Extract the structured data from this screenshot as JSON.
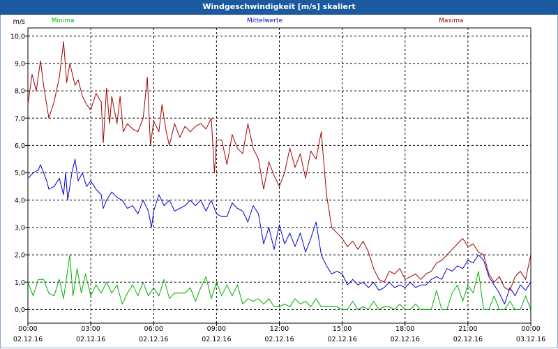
{
  "window": {
    "title": "Windgeschwindigkeit [m/s] skaliert"
  },
  "colors": {
    "min": "#00b000",
    "avg": "#0000c8",
    "max": "#a00000",
    "grid": "#000000",
    "title_bg": "#1c5aa0"
  },
  "chart_data": {
    "type": "line",
    "title": "Windgeschwindigkeit [m/s] skaliert",
    "ylabel": "m/s",
    "ylim": [
      -0.5,
      10.3
    ],
    "xlim": [
      0,
      24
    ],
    "grid": true,
    "yticks": [
      0,
      1,
      2,
      3,
      4,
      5,
      6,
      7,
      8,
      9,
      10
    ],
    "ytick_labels": [
      "0,0",
      "1,0",
      "2,0",
      "3,0",
      "4,0",
      "5,0",
      "6,0",
      "7,0",
      "8,0",
      "9,0",
      "10,0"
    ],
    "x_ticks": [
      0,
      3,
      6,
      9,
      12,
      15,
      18,
      21,
      24
    ],
    "x_time_labels": [
      "00:00",
      "03:00",
      "06:00",
      "09:00",
      "12:00",
      "15:00",
      "18:00",
      "21:00",
      "00:00"
    ],
    "x_date_labels": [
      "02.12.16",
      "02.12.16",
      "02.12.16",
      "02.12.16",
      "02.12.16",
      "02.12.16",
      "02.12.16",
      "02.12.16",
      "03.12.16"
    ],
    "series": [
      {
        "name": "Minima",
        "color": "#00b000",
        "points": [
          [
            0,
            1.0
          ],
          [
            0.25,
            0.5
          ],
          [
            0.5,
            1.1
          ],
          [
            0.75,
            1.1
          ],
          [
            1.0,
            0.6
          ],
          [
            1.25,
            0.5
          ],
          [
            1.5,
            1.1
          ],
          [
            1.7,
            0.4
          ],
          [
            2.0,
            2.0
          ],
          [
            2.15,
            0.5
          ],
          [
            2.35,
            1.5
          ],
          [
            2.55,
            0.6
          ],
          [
            2.75,
            1.3
          ],
          [
            3.0,
            0.5
          ],
          [
            3.25,
            0.9
          ],
          [
            3.5,
            0.6
          ],
          [
            3.75,
            1.0
          ],
          [
            4.0,
            0.6
          ],
          [
            4.25,
            0.9
          ],
          [
            4.5,
            0.2
          ],
          [
            4.75,
            0.6
          ],
          [
            5.0,
            0.9
          ],
          [
            5.25,
            0.5
          ],
          [
            5.5,
            1.0
          ],
          [
            5.75,
            0.5
          ],
          [
            6.0,
            0.8
          ],
          [
            6.25,
            0.5
          ],
          [
            6.5,
            1.1
          ],
          [
            6.75,
            0.4
          ],
          [
            7.0,
            0.6
          ],
          [
            7.25,
            0.6
          ],
          [
            7.5,
            0.6
          ],
          [
            7.75,
            0.8
          ],
          [
            8.0,
            0.3
          ],
          [
            8.25,
            0.8
          ],
          [
            8.5,
            1.2
          ],
          [
            8.75,
            0.4
          ],
          [
            9.0,
            1.0
          ],
          [
            9.25,
            0.5
          ],
          [
            9.5,
            0.9
          ],
          [
            9.75,
            0.5
          ],
          [
            10.0,
            0.9
          ],
          [
            10.25,
            0.2
          ],
          [
            10.5,
            0.4
          ],
          [
            10.75,
            0.3
          ],
          [
            11.0,
            0.4
          ],
          [
            11.25,
            0.2
          ],
          [
            11.5,
            0.4
          ],
          [
            11.75,
            0.1
          ],
          [
            12.0,
            0.1
          ],
          [
            12.25,
            0.2
          ],
          [
            12.5,
            0.1
          ],
          [
            12.75,
            0.4
          ],
          [
            13.0,
            0.2
          ],
          [
            13.25,
            0.3
          ],
          [
            13.5,
            0.1
          ],
          [
            13.75,
            0.4
          ],
          [
            14.0,
            0.1
          ],
          [
            14.5,
            0.1
          ],
          [
            14.75,
            0.1
          ],
          [
            15.0,
            0.0
          ],
          [
            15.25,
            0.0
          ],
          [
            15.5,
            0.3
          ],
          [
            15.75,
            0.0
          ],
          [
            16.0,
            0.1
          ],
          [
            16.25,
            0.0
          ],
          [
            16.5,
            0.3
          ],
          [
            16.75,
            0.0
          ],
          [
            17.0,
            0.1
          ],
          [
            17.25,
            0.1
          ],
          [
            17.5,
            0.0
          ],
          [
            17.75,
            0.2
          ],
          [
            18.0,
            0.0
          ],
          [
            18.25,
            0.0
          ],
          [
            18.5,
            0.2
          ],
          [
            18.75,
            0.0
          ],
          [
            19.0,
            0.0
          ],
          [
            19.25,
            0.0
          ],
          [
            19.5,
            0.7
          ],
          [
            19.75,
            0.0
          ],
          [
            20.0,
            0.0
          ],
          [
            20.25,
            0.6
          ],
          [
            20.5,
            0.9
          ],
          [
            20.75,
            0.3
          ],
          [
            21.0,
            0.9
          ],
          [
            21.25,
            0.6
          ],
          [
            21.5,
            1.4
          ],
          [
            21.75,
            0.0
          ],
          [
            22.0,
            0.0
          ],
          [
            22.25,
            0.5
          ],
          [
            22.5,
            0.0
          ],
          [
            22.75,
            0.0
          ],
          [
            23.0,
            0.3
          ],
          [
            23.25,
            0.0
          ],
          [
            23.5,
            0.0
          ],
          [
            23.75,
            0.5
          ],
          [
            24.0,
            0.0
          ]
        ]
      },
      {
        "name": "Mittelwerte",
        "color": "#0000c8",
        "points": [
          [
            0,
            4.8
          ],
          [
            0.25,
            5.0
          ],
          [
            0.5,
            5.1
          ],
          [
            0.6,
            5.3
          ],
          [
            0.9,
            4.7
          ],
          [
            1.0,
            4.4
          ],
          [
            1.25,
            4.5
          ],
          [
            1.5,
            4.8
          ],
          [
            1.7,
            4.2
          ],
          [
            1.8,
            5.0
          ],
          [
            1.9,
            4.0
          ],
          [
            2.1,
            5.0
          ],
          [
            2.25,
            5.5
          ],
          [
            2.4,
            4.7
          ],
          [
            2.6,
            5.0
          ],
          [
            2.8,
            4.5
          ],
          [
            3.0,
            4.7
          ],
          [
            3.25,
            4.4
          ],
          [
            3.5,
            4.2
          ],
          [
            3.6,
            3.7
          ],
          [
            3.75,
            4.0
          ],
          [
            4.0,
            4.3
          ],
          [
            4.25,
            4.1
          ],
          [
            4.5,
            4.0
          ],
          [
            4.75,
            3.7
          ],
          [
            5.0,
            3.8
          ],
          [
            5.25,
            3.5
          ],
          [
            5.5,
            4.0
          ],
          [
            5.75,
            3.6
          ],
          [
            5.9,
            3.0
          ],
          [
            6.0,
            3.6
          ],
          [
            6.25,
            4.2
          ],
          [
            6.5,
            3.8
          ],
          [
            6.75,
            4.0
          ],
          [
            7.0,
            3.6
          ],
          [
            7.25,
            3.7
          ],
          [
            7.5,
            3.8
          ],
          [
            7.75,
            4.0
          ],
          [
            8.0,
            3.8
          ],
          [
            8.25,
            4.0
          ],
          [
            8.5,
            3.6
          ],
          [
            8.75,
            4.0
          ],
          [
            9.0,
            3.5
          ],
          [
            9.25,
            3.4
          ],
          [
            9.5,
            3.4
          ],
          [
            9.75,
            3.9
          ],
          [
            10.0,
            3.7
          ],
          [
            10.25,
            3.6
          ],
          [
            10.5,
            3.2
          ],
          [
            10.75,
            3.8
          ],
          [
            11.0,
            3.5
          ],
          [
            11.25,
            2.4
          ],
          [
            11.5,
            3.0
          ],
          [
            11.75,
            2.2
          ],
          [
            12.0,
            3.1
          ],
          [
            12.25,
            2.4
          ],
          [
            12.5,
            2.8
          ],
          [
            12.75,
            2.3
          ],
          [
            13.0,
            2.8
          ],
          [
            13.25,
            2.1
          ],
          [
            13.5,
            2.6
          ],
          [
            13.75,
            3.2
          ],
          [
            14.0,
            2.0
          ],
          [
            14.25,
            1.6
          ],
          [
            14.5,
            1.3
          ],
          [
            14.75,
            1.4
          ],
          [
            15.0,
            1.3
          ],
          [
            15.25,
            0.9
          ],
          [
            15.5,
            1.1
          ],
          [
            15.75,
            0.9
          ],
          [
            16.0,
            1.0
          ],
          [
            16.25,
            0.8
          ],
          [
            16.5,
            1.0
          ],
          [
            16.75,
            0.7
          ],
          [
            17.0,
            0.8
          ],
          [
            17.25,
            1.0
          ],
          [
            17.5,
            0.8
          ],
          [
            17.75,
            0.9
          ],
          [
            18.0,
            0.8
          ],
          [
            18.25,
            1.0
          ],
          [
            18.5,
            0.8
          ],
          [
            18.75,
            0.9
          ],
          [
            19.0,
            0.9
          ],
          [
            19.25,
            1.1
          ],
          [
            19.5,
            1.2
          ],
          [
            19.75,
            1.1
          ],
          [
            20.0,
            1.5
          ],
          [
            20.25,
            1.4
          ],
          [
            20.5,
            1.6
          ],
          [
            20.75,
            1.5
          ],
          [
            21.0,
            1.8
          ],
          [
            21.25,
            1.7
          ],
          [
            21.5,
            2.0
          ],
          [
            21.75,
            1.8
          ],
          [
            22.0,
            1.2
          ],
          [
            22.25,
            0.9
          ],
          [
            22.5,
            0.6
          ],
          [
            22.75,
            0.2
          ],
          [
            23.0,
            0.8
          ],
          [
            23.25,
            0.5
          ],
          [
            23.5,
            0.9
          ],
          [
            23.75,
            0.7
          ],
          [
            24.0,
            1.0
          ]
        ]
      },
      {
        "name": "Maxima",
        "color": "#a00000",
        "points": [
          [
            0,
            7.5
          ],
          [
            0.2,
            8.6
          ],
          [
            0.4,
            8.0
          ],
          [
            0.6,
            9.1
          ],
          [
            0.75,
            8.2
          ],
          [
            1.0,
            7.0
          ],
          [
            1.25,
            7.6
          ],
          [
            1.5,
            8.5
          ],
          [
            1.7,
            9.8
          ],
          [
            1.85,
            8.3
          ],
          [
            2.0,
            9.0
          ],
          [
            2.25,
            8.2
          ],
          [
            2.4,
            8.4
          ],
          [
            2.6,
            7.8
          ],
          [
            2.8,
            7.5
          ],
          [
            3.0,
            7.3
          ],
          [
            3.25,
            7.9
          ],
          [
            3.5,
            7.6
          ],
          [
            3.6,
            6.1
          ],
          [
            3.75,
            8.1
          ],
          [
            3.9,
            6.8
          ],
          [
            4.0,
            7.8
          ],
          [
            4.25,
            6.8
          ],
          [
            4.4,
            7.8
          ],
          [
            4.55,
            6.5
          ],
          [
            4.75,
            6.8
          ],
          [
            5.0,
            6.6
          ],
          [
            5.25,
            6.5
          ],
          [
            5.5,
            7.0
          ],
          [
            5.7,
            8.5
          ],
          [
            5.85,
            6.0
          ],
          [
            6.0,
            6.9
          ],
          [
            6.25,
            6.5
          ],
          [
            6.4,
            7.5
          ],
          [
            6.6,
            6.5
          ],
          [
            6.75,
            6.0
          ],
          [
            7.0,
            6.8
          ],
          [
            7.25,
            6.3
          ],
          [
            7.5,
            6.7
          ],
          [
            7.75,
            6.5
          ],
          [
            8.0,
            6.7
          ],
          [
            8.25,
            6.8
          ],
          [
            8.5,
            6.6
          ],
          [
            8.75,
            7.0
          ],
          [
            8.9,
            5.0
          ],
          [
            9.0,
            6.2
          ],
          [
            9.25,
            6.2
          ],
          [
            9.5,
            5.3
          ],
          [
            9.75,
            6.4
          ],
          [
            10.0,
            5.9
          ],
          [
            10.25,
            5.7
          ],
          [
            10.5,
            6.8
          ],
          [
            10.75,
            5.9
          ],
          [
            11.0,
            5.5
          ],
          [
            11.25,
            4.4
          ],
          [
            11.5,
            5.4
          ],
          [
            11.75,
            4.9
          ],
          [
            12.0,
            4.5
          ],
          [
            12.25,
            5.0
          ],
          [
            12.5,
            5.9
          ],
          [
            12.75,
            5.2
          ],
          [
            13.0,
            5.7
          ],
          [
            13.25,
            4.8
          ],
          [
            13.5,
            5.8
          ],
          [
            13.75,
            5.5
          ],
          [
            14.0,
            6.5
          ],
          [
            14.25,
            4.2
          ],
          [
            14.5,
            3.0
          ],
          [
            14.75,
            2.8
          ],
          [
            15.0,
            2.6
          ],
          [
            15.25,
            2.3
          ],
          [
            15.5,
            2.5
          ],
          [
            15.75,
            2.2
          ],
          [
            16.0,
            2.5
          ],
          [
            16.25,
            2.1
          ],
          [
            16.5,
            1.5
          ],
          [
            16.75,
            1.1
          ],
          [
            17.0,
            1.0
          ],
          [
            17.25,
            1.4
          ],
          [
            17.5,
            1.3
          ],
          [
            17.75,
            1.5
          ],
          [
            18.0,
            1.1
          ],
          [
            18.25,
            1.2
          ],
          [
            18.5,
            1.3
          ],
          [
            18.75,
            1.1
          ],
          [
            19.0,
            1.3
          ],
          [
            19.25,
            1.4
          ],
          [
            19.5,
            1.7
          ],
          [
            19.75,
            1.8
          ],
          [
            20.0,
            2.0
          ],
          [
            20.25,
            2.2
          ],
          [
            20.5,
            2.4
          ],
          [
            20.75,
            2.6
          ],
          [
            21.0,
            2.3
          ],
          [
            21.25,
            2.4
          ],
          [
            21.5,
            2.1
          ],
          [
            21.75,
            2.0
          ],
          [
            22.0,
            1.3
          ],
          [
            22.25,
            1.0
          ],
          [
            22.5,
            1.2
          ],
          [
            22.75,
            0.8
          ],
          [
            23.0,
            0.7
          ],
          [
            23.25,
            1.2
          ],
          [
            23.5,
            1.4
          ],
          [
            23.75,
            1.1
          ],
          [
            24.0,
            2.0
          ]
        ]
      }
    ]
  }
}
